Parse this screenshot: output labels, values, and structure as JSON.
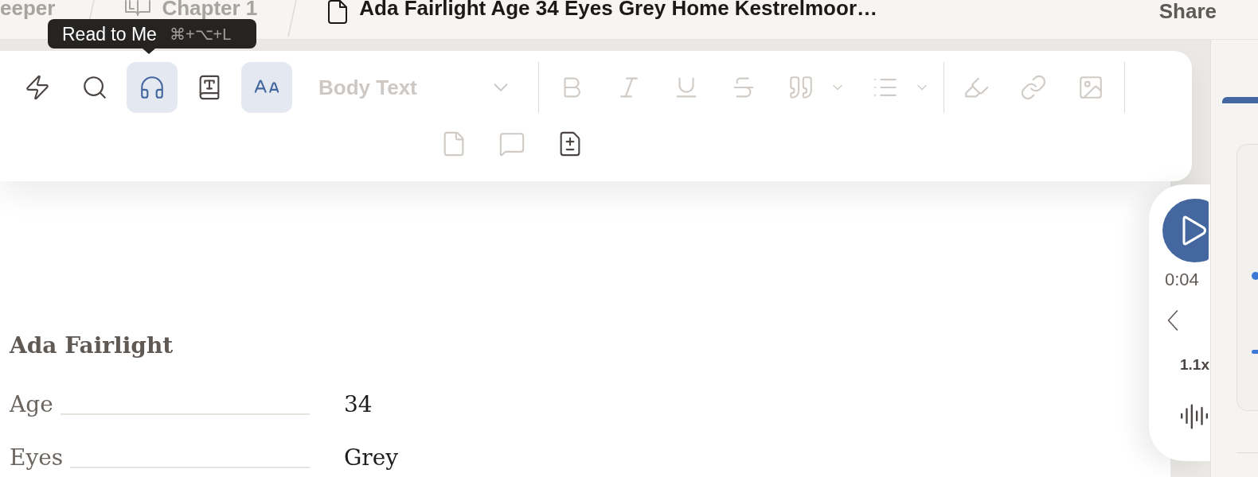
{
  "breadcrumbs": [
    {
      "label": "eeper",
      "kind": "project",
      "current": false
    },
    {
      "label": "Chapter 1",
      "kind": "chapter",
      "current": false
    },
    {
      "label": "Ada Fairlight Age 34 Eyes Grey Home Kestrelmoor…",
      "kind": "document",
      "current": true
    }
  ],
  "share": "Share",
  "tooltip": {
    "label": "Read to Me",
    "shortcut": "⌘+⌥+L"
  },
  "toolbar": {
    "actions": [
      {
        "selected": false
      },
      {
        "selected": false
      },
      {
        "selected": true
      },
      {
        "selected": false
      },
      {
        "selected": true
      }
    ],
    "style_select": {
      "value": "Body Text",
      "disabled": true
    },
    "format": [
      {
        "disabled": true,
        "menu": false
      },
      {
        "disabled": true,
        "menu": false
      },
      {
        "disabled": true,
        "menu": false
      },
      {
        "disabled": true,
        "menu": false
      },
      {
        "disabled": true,
        "menu": true
      },
      {
        "disabled": true,
        "menu": true
      }
    ],
    "insert": [
      {
        "disabled": true
      },
      {
        "disabled": true
      },
      {
        "disabled": true
      }
    ],
    "more": [
      {
        "disabled": true
      },
      {
        "disabled": true
      },
      {
        "disabled": false
      }
    ]
  },
  "document": {
    "heading": "Ada Fairlight",
    "fields": [
      {
        "label": "Age",
        "value": "34"
      },
      {
        "label": "Eyes",
        "value": "Grey"
      }
    ]
  },
  "player": {
    "time": "0:04",
    "speed": "1.1x"
  },
  "side_panel": {
    "tabs": [
      {
        "selected": true
      }
    ]
  }
}
